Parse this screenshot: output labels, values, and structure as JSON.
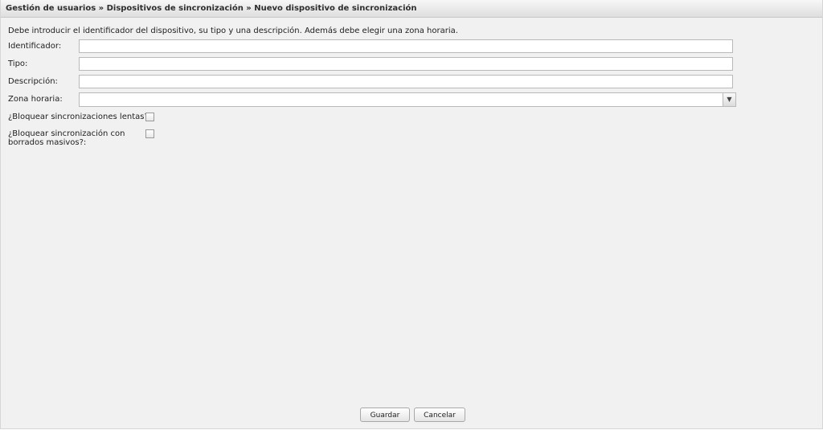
{
  "breadcrumb": "Gestión de usuarios » Dispositivos de sincronización » Nuevo dispositivo de sincronización",
  "intro": "Debe introducir el identificador del dispositivo, su tipo y una descripción. Además debe elegir una zona horaria.",
  "fields": {
    "identificador": {
      "label": "Identificador:",
      "value": ""
    },
    "tipo": {
      "label": "Tipo:",
      "value": ""
    },
    "descripcion": {
      "label": "Descripción:",
      "value": ""
    },
    "zona": {
      "label": "Zona horaria:",
      "value": ""
    }
  },
  "checkboxes": {
    "lentas": {
      "label": "¿Bloquear sincronizaciones lentas?:",
      "checked": false
    },
    "masivos": {
      "label_line1": "¿Bloquear sincronización con",
      "label_line2": "borrados masivos?:",
      "checked": false
    }
  },
  "buttons": {
    "guardar": "Guardar",
    "cancelar": "Cancelar"
  },
  "icons": {
    "select_arrow": "chevron-down-icon"
  }
}
